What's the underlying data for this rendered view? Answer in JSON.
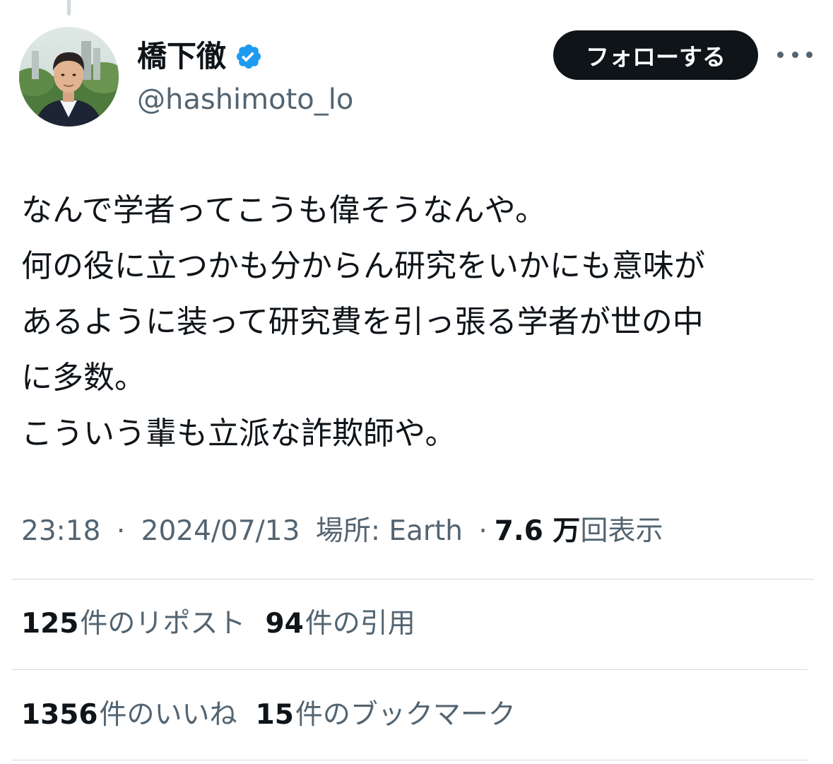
{
  "user": {
    "display_name": "橋下徹",
    "handle": "@hashimoto_lo",
    "verified": true,
    "avatar_icon": "profile-photo"
  },
  "follow_label": "フォローする",
  "more_icon": "more-horizontal-icon",
  "tweet_lines": [
    "なんで学者ってこうも偉そうなんや。",
    "何の役に立つかも分からん研究をいかにも意味が",
    "あるように装って研究費を引っ張る学者が世の中",
    "に多数。",
    "こういう輩も立派な詐欺師や。"
  ],
  "meta": {
    "time": "23:18",
    "date": "2024/07/13",
    "location_label": "場所: Earth",
    "views_count": "7.6 万",
    "views_label": "回表示",
    "separator": "·"
  },
  "stats": {
    "reposts_count": "125",
    "reposts_label": "件のリポスト",
    "quotes_count": "94",
    "quotes_label": "件の引用",
    "likes_count": "1356",
    "likes_label": "件のいいね",
    "bookmarks_count": "15",
    "bookmarks_label": "件のブックマーク"
  },
  "colors": {
    "text": "#0f1419",
    "secondary": "#536471",
    "verified_blue": "#1d9bf0",
    "divider": "#cfd9de",
    "button_bg": "#0f1419"
  }
}
